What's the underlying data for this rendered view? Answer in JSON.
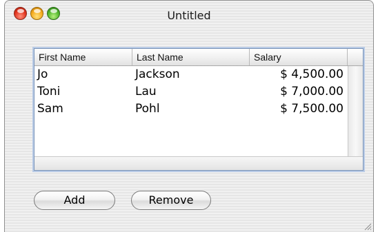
{
  "window": {
    "title": "Untitled"
  },
  "table": {
    "columns": [
      "First Name",
      "Last Name",
      "Salary"
    ],
    "rows": [
      {
        "first": "Jo",
        "last": "Jackson",
        "salary": "$ 4,500.00"
      },
      {
        "first": "Toni",
        "last": "Lau",
        "salary": "$ 7,000.00"
      },
      {
        "first": "Sam",
        "last": "Pohl",
        "salary": "$ 7,500.00"
      }
    ]
  },
  "buttons": {
    "add_label": "Add",
    "remove_label": "Remove"
  },
  "icons": {
    "close": "close-icon",
    "minimize": "minimize-icon",
    "zoom": "zoom-icon",
    "resize": "resize-grip-icon"
  }
}
